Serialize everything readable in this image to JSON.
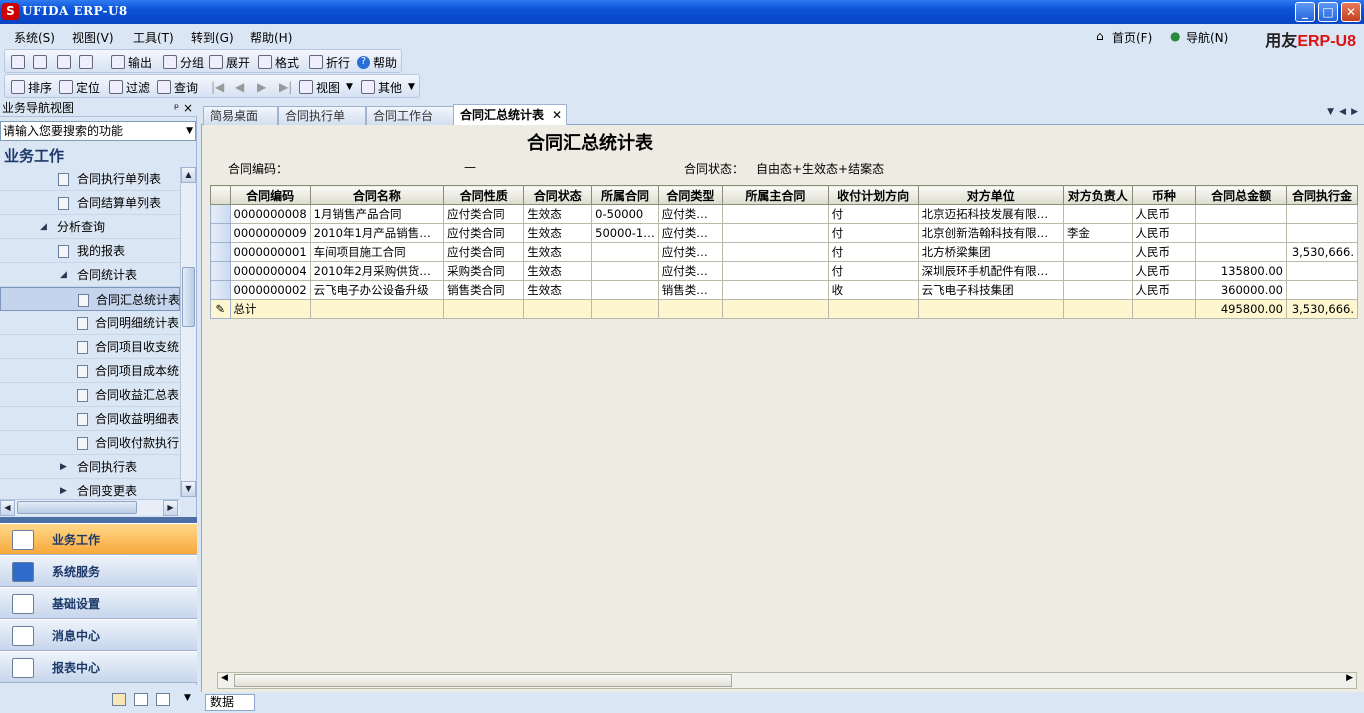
{
  "window": {
    "title": "UFIDA ERP-U8",
    "logo": "S",
    "btn_min": "_",
    "btn_max": "□",
    "btn_close": "✕"
  },
  "menu": {
    "items": [
      "系统(S)",
      "视图(V)",
      "工具(T)",
      "转到(G)",
      "帮助(H)"
    ],
    "home": "首页(F)",
    "nav": "导航(N)",
    "brand_a": "用友",
    "brand_b": "ERP-U8"
  },
  "toolbar1": {
    "output": "输出",
    "group": "分组",
    "expand": "展开",
    "format": "格式",
    "fold": "折行",
    "help": "帮助"
  },
  "toolbar2": {
    "sort": "排序",
    "locate": "定位",
    "filter": "过滤",
    "query": "查询",
    "view": "视图",
    "other": "其他"
  },
  "left": {
    "header": "业务导航视图",
    "pin": "ᵖ ×",
    "search_placeholder": "请输入您要搜索的功能",
    "section": "业务工作",
    "tree": [
      {
        "label": "合同执行单列表"
      },
      {
        "label": "合同结算单列表"
      },
      {
        "label": "分析查询"
      },
      {
        "label": "我的报表"
      },
      {
        "label": "合同统计表"
      },
      {
        "label": "合同汇总统计表"
      },
      {
        "label": "合同明细统计表"
      },
      {
        "label": "合同项目收支统"
      },
      {
        "label": "合同项目成本统"
      },
      {
        "label": "合同收益汇总表"
      },
      {
        "label": "合同收益明细表"
      },
      {
        "label": "合同收付款执行"
      },
      {
        "label": "合同执行表"
      },
      {
        "label": "合同变更表"
      }
    ],
    "nav_buttons": [
      "业务工作",
      "系统服务",
      "基础设置",
      "消息中心",
      "报表中心"
    ]
  },
  "tabs": [
    "简易桌面",
    "合同执行单",
    "合同工作台",
    "合同汇总统计表"
  ],
  "report": {
    "title": "合同汇总统计表",
    "code_label": "合同编码：",
    "code_value": "—",
    "status_label": "合同状态：",
    "status_value": "自由态+生效态+结案态",
    "columns": [
      "合同编码",
      "合同名称",
      "合同性质",
      "合同状态",
      "所属合同",
      "合同类型",
      "所属主合同",
      "收付计划方向",
      "对方单位",
      "对方负责人",
      "币种",
      "合同总金额",
      "合同执行金"
    ],
    "rows": [
      [
        "0000000008",
        "1月销售产品合同",
        "应付类合同",
        "生效态",
        "0-50000",
        "应付类…",
        "",
        "付",
        "北京迈拓科技发展有限…",
        "",
        "人民币",
        "",
        ""
      ],
      [
        "0000000009",
        "2010年1月产品销售…",
        "应付类合同",
        "生效态",
        "50000-1…",
        "应付类…",
        "",
        "付",
        "北京创新浩翰科技有限…",
        "李金",
        "人民币",
        "",
        ""
      ],
      [
        "0000000001",
        "车间项目施工合同",
        "应付类合同",
        "生效态",
        "",
        "应付类…",
        "",
        "付",
        "北方桥梁集团",
        "",
        "人民币",
        "",
        "3,530,666."
      ],
      [
        "0000000004",
        "2010年2月采购供货…",
        "采购类合同",
        "生效态",
        "",
        "应付类…",
        "",
        "付",
        "深圳辰环手机配件有限…",
        "",
        "人民币",
        "135800.00",
        ""
      ],
      [
        "0000000002",
        "云飞电子办公设备升级",
        "销售类合同",
        "生效态",
        "",
        "销售类…",
        "",
        "收",
        "云飞电子科技集团",
        "",
        "人民币",
        "360000.00",
        ""
      ]
    ],
    "total": {
      "label": "总计",
      "amount": "495800.00",
      "exec": "3,530,666."
    }
  },
  "status_tab": "数据"
}
